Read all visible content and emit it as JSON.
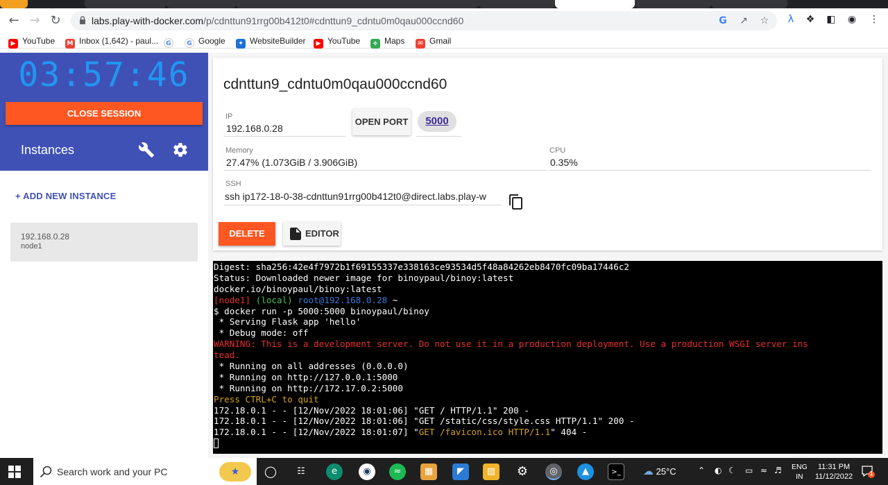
{
  "browser": {
    "url_host": "labs.play-with-docker.com",
    "url_path": "/p/cdnttun91rrg00b412t0#cdnttun9_cdntu0m0qau000ccnd60",
    "bookmarks": [
      {
        "label": "YouTube",
        "icon": "youtube-icon",
        "color": "#ff0000"
      },
      {
        "label": "Inbox (1,642) - paul...",
        "icon": "gmail-icon",
        "color": "#ea4335"
      },
      {
        "label": "",
        "icon": "google-icon",
        "color": "#4285f4"
      },
      {
        "label": "Google",
        "icon": "google-icon",
        "color": "#4285f4"
      },
      {
        "label": "WebsiteBuilder",
        "icon": "websitebuilder-icon",
        "color": "#1e6fd9"
      },
      {
        "label": "YouTube",
        "icon": "youtube-icon",
        "color": "#ff0000"
      },
      {
        "label": "Maps",
        "icon": "maps-icon",
        "color": "#34a853"
      },
      {
        "label": "Gmail",
        "icon": "gmail-icon",
        "color": "#ea4335"
      }
    ]
  },
  "sidebar": {
    "timer": "03:57:46",
    "close_session_label": "CLOSE SESSION",
    "instances_title": "Instances",
    "add_instance_label": "+ ADD NEW INSTANCE",
    "instances": [
      {
        "ip": "192.168.0.28",
        "name": "node1"
      }
    ]
  },
  "instance": {
    "hostname": "cdnttun9_cdntu0m0qau000ccnd60",
    "ip_label": "IP",
    "ip": "192.168.0.28",
    "open_port_label": "OPEN PORT",
    "port": "5000",
    "memory_label": "Memory",
    "memory": "27.47% (1.073GiB / 3.906GiB)",
    "cpu_label": "CPU",
    "cpu": "0.35%",
    "ssh_label": "SSH",
    "ssh": "ssh ip172-18-0-38-cdnttun91rrg00b412t0@direct.labs.play-w",
    "delete_label": "DELETE",
    "editor_label": "EDITOR"
  },
  "terminal": {
    "lines": [
      {
        "segments": [
          {
            "text": "Digest: sha256:42e4f7972b1f69155337e338163ce93534d5f48a84262eb8470fc09ba17446c2",
            "color": "white"
          }
        ]
      },
      {
        "segments": [
          {
            "text": "Status: Downloaded newer image for binoypaul/binoy:latest",
            "color": "white"
          }
        ]
      },
      {
        "segments": [
          {
            "text": "docker.io/binoypaul/binoy:latest",
            "color": "white"
          }
        ]
      },
      {
        "segments": [
          {
            "text": "[node1] ",
            "color": "red"
          },
          {
            "text": "(local) ",
            "color": "green"
          },
          {
            "text": "root@192.168.0.28",
            "color": "blue"
          },
          {
            "text": " ~",
            "color": "white"
          }
        ]
      },
      {
        "segments": [
          {
            "text": "$ docker run -p 5000:5000 binoypaul/binoy",
            "color": "white"
          }
        ]
      },
      {
        "segments": [
          {
            "text": " * Serving Flask app 'hello'",
            "color": "white"
          }
        ]
      },
      {
        "segments": [
          {
            "text": " * Debug mode: off",
            "color": "white"
          }
        ]
      },
      {
        "segments": [
          {
            "text": "WARNING: This is a development server. Do not use it in a production deployment. Use a production WSGI server ins",
            "color": "red"
          }
        ]
      },
      {
        "segments": [
          {
            "text": "tead.",
            "color": "red"
          }
        ]
      },
      {
        "segments": [
          {
            "text": " * Running on all addresses (0.0.0.0)",
            "color": "white"
          }
        ]
      },
      {
        "segments": [
          {
            "text": " * Running on http://127.0.0.1:5000",
            "color": "white"
          }
        ]
      },
      {
        "segments": [
          {
            "text": " * Running on http://172.17.0.2:5000",
            "color": "white"
          }
        ]
      },
      {
        "segments": [
          {
            "text": "Press CTRL+C to quit",
            "color": "yellow"
          }
        ]
      },
      {
        "segments": [
          {
            "text": "172.18.0.1 - - [12/Nov/2022 18:01:06] \"GET / HTTP/1.1\" 200 -",
            "color": "white"
          }
        ]
      },
      {
        "segments": [
          {
            "text": "172.18.0.1 - - [12/Nov/2022 18:01:06] \"GET /static/css/style.css HTTP/1.1\" 200 -",
            "color": "white"
          }
        ]
      },
      {
        "segments": [
          {
            "text": "172.18.0.1 - - [12/Nov/2022 18:01:07] \"",
            "color": "white"
          },
          {
            "text": "GET /favicon.ico HTTP/1.1",
            "color": "yellow"
          },
          {
            "text": "\" 404 -",
            "color": "white"
          }
        ]
      }
    ]
  },
  "taskbar": {
    "search_placeholder": "Search work and your PC",
    "temperature": "25°C",
    "lang_top": "ENG",
    "lang_bottom": "IN",
    "time": "11:31 PM",
    "date": "11/12/2022",
    "notification_count": "1"
  },
  "colors": {
    "accent": "#3f51b5",
    "danger": "#ff5722",
    "timer": "#2196f3"
  }
}
